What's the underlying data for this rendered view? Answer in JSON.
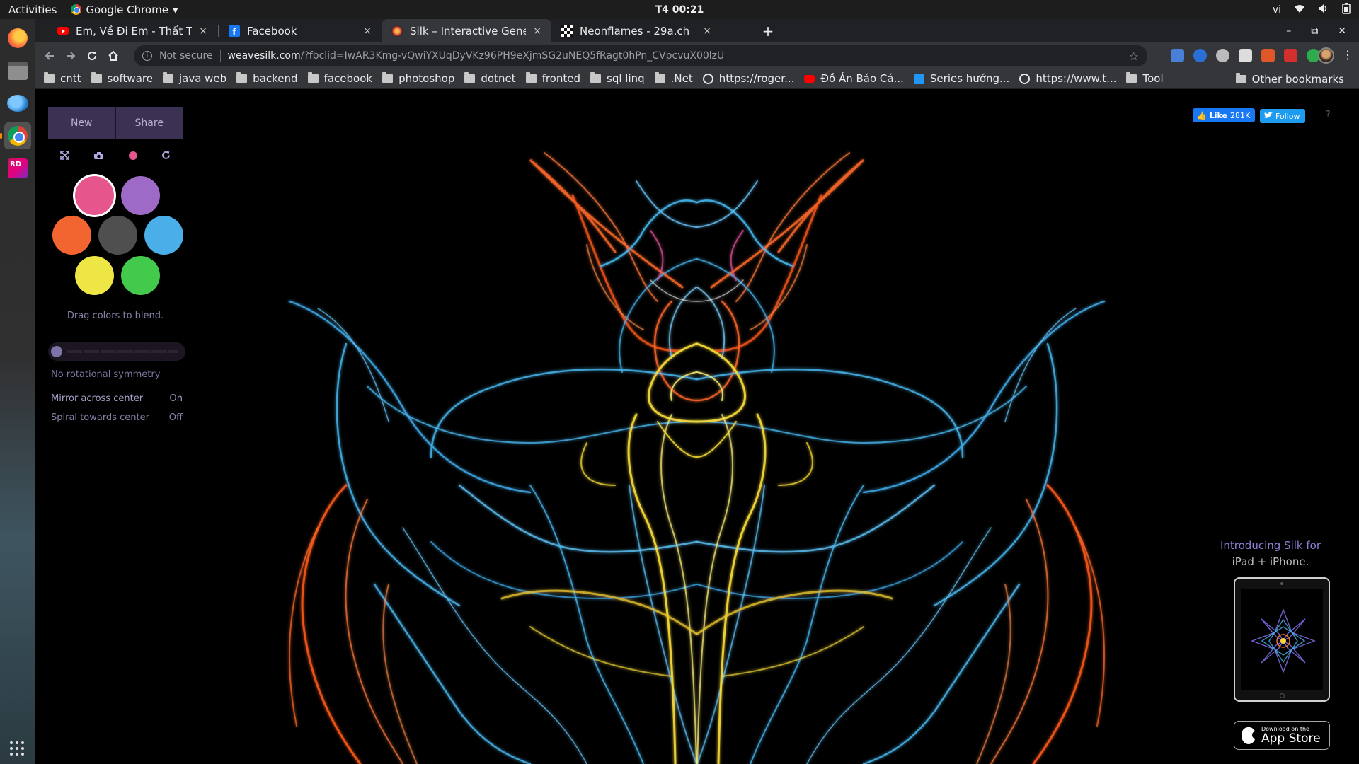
{
  "os": {
    "activities": "Activities",
    "app_menu": "Google Chrome",
    "clock": "T4 00:21",
    "input_method": "vi",
    "menu_caret": "▾"
  },
  "tabs": [
    {
      "title": "Em, Về Đi Em - Thất Tình",
      "favicon": "youtube-icon"
    },
    {
      "title": "Facebook",
      "favicon": "facebook-icon"
    },
    {
      "title": "Silk – Interactive Generative Art",
      "favicon": "silk-icon",
      "active": true
    },
    {
      "title": "Neonflames - 29a.ch",
      "favicon": "neonflames-icon"
    }
  ],
  "tab_close": "×",
  "new_tab": "+",
  "window_controls": {
    "minimize": "–",
    "restore": "⧉",
    "close": "✕"
  },
  "address_bar": {
    "security_label": "Not secure",
    "host": "weavesilk.com",
    "path": "/?fbclid=IwAR3Kmg-vQwiYXUqDyVKz96PH9eXjmSG2uNEQ5fRagt0hPn_CVpcvuX00lzU"
  },
  "bookmarks": [
    {
      "label": "cntt",
      "icon": "folder-icon"
    },
    {
      "label": "software",
      "icon": "folder-icon"
    },
    {
      "label": "java web",
      "icon": "folder-icon"
    },
    {
      "label": "backend",
      "icon": "folder-icon"
    },
    {
      "label": "facebook",
      "icon": "folder-icon"
    },
    {
      "label": "photoshop",
      "icon": "folder-icon"
    },
    {
      "label": "dotnet",
      "icon": "folder-icon"
    },
    {
      "label": "fronted",
      "icon": "folder-icon"
    },
    {
      "label": "sql linq",
      "icon": "folder-icon"
    },
    {
      "label": ".Net",
      "icon": "folder-icon"
    },
    {
      "label": "https://roger...",
      "icon": "globe-icon"
    },
    {
      "label": "Đồ Án Báo Cá...",
      "icon": "youtube-icon"
    },
    {
      "label": "Series hướng...",
      "icon": "bookmark-site-icon"
    },
    {
      "label": "https://www.t...",
      "icon": "globe-icon"
    },
    {
      "label": "Tool",
      "icon": "folder-icon"
    }
  ],
  "other_bookmarks": "Other bookmarks",
  "silk": {
    "new_label": "New",
    "share_label": "Share",
    "swatches": [
      "#e7558d",
      "#9e6ac7",
      "#f26430",
      "#4f4f4f",
      "#4aaee8",
      "#eee644",
      "#43c94b"
    ],
    "hint": "Drag colors to blend.",
    "symmetry_label": "No rotational symmetry",
    "symmetry_level": 0,
    "mirror_label": "Mirror across center",
    "mirror_value": "On",
    "spiral_label": "Spiral towards center",
    "spiral_value": "Off"
  },
  "social": {
    "like_label": "Like",
    "like_count": "281K",
    "follow_label": "Follow",
    "help": "?"
  },
  "promo": {
    "line1": "Introducing Silk for",
    "line2": "iPad + iPhone.",
    "appstore_small": "Download on the",
    "appstore_big": "App Store"
  }
}
